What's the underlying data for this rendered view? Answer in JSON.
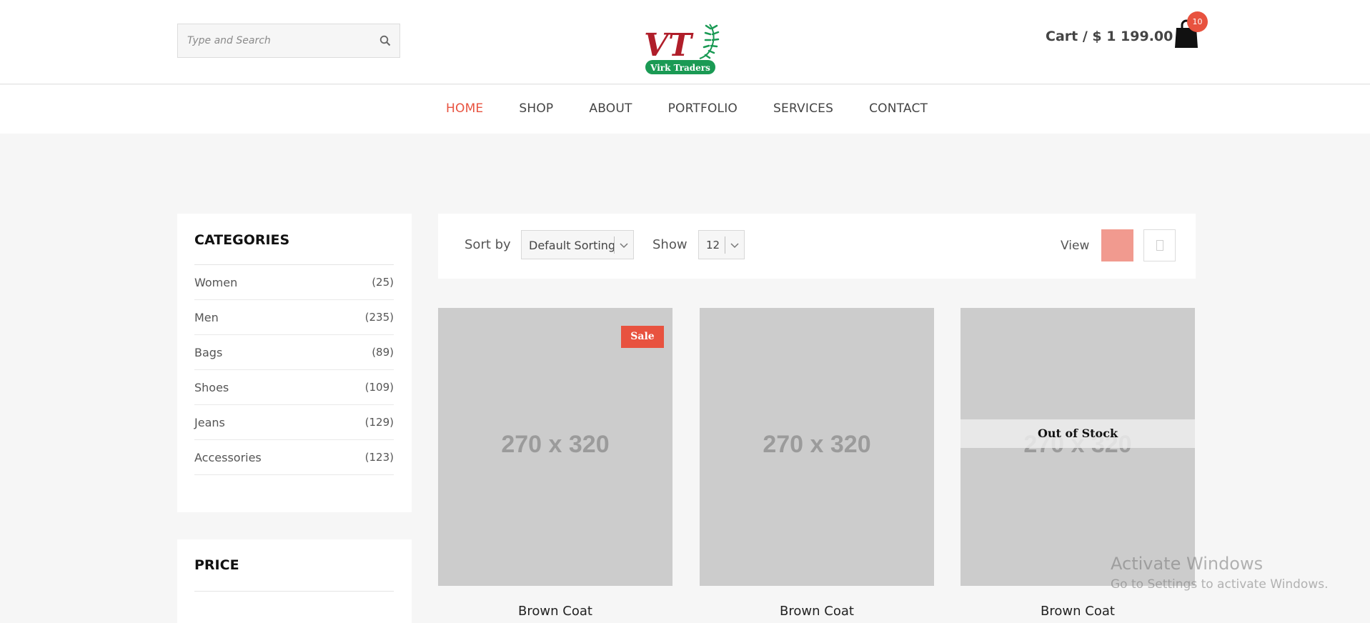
{
  "header": {
    "search_placeholder": "Type and Search",
    "logo_text": "VT",
    "logo_sub": "Virk Traders",
    "cart_text": "Cart / $ 1 199.00",
    "cart_count": "10"
  },
  "nav": {
    "items": [
      "HOME",
      "SHOP",
      "ABOUT",
      "PORTFOLIO",
      "SERVICES",
      "CONTACT"
    ],
    "active": "HOME"
  },
  "sidebar": {
    "categories_title": "CATEGORIES",
    "categories": [
      {
        "name": "Women",
        "count": "(25)"
      },
      {
        "name": "Men",
        "count": "(235)"
      },
      {
        "name": "Bags",
        "count": "(89)"
      },
      {
        "name": "Shoes",
        "count": "(109)"
      },
      {
        "name": "Jeans",
        "count": "(129)"
      },
      {
        "name": "Accessories",
        "count": "(123)"
      }
    ],
    "price_title": "PRICE"
  },
  "toolbar": {
    "sort_label": "Sort by",
    "sort_value": "Default Sorting",
    "show_label": "Show",
    "show_value": "12",
    "view_label": "View"
  },
  "products": [
    {
      "placeholder": "270 x 320",
      "badge": "Sale",
      "name": "Brown Coat"
    },
    {
      "placeholder": "270 x 320",
      "name": "Brown Coat"
    },
    {
      "placeholder": "270 x 320",
      "overlay": "Out of Stock",
      "name": "Brown Coat"
    }
  ],
  "watermark": {
    "line1": "Activate Windows",
    "line2": "Go to Settings to activate Windows."
  },
  "colors": {
    "accent": "#e8523f",
    "grid_view_active": "#f19a8f",
    "logo_red": "#b01e2a",
    "logo_green": "#1a9a54"
  }
}
